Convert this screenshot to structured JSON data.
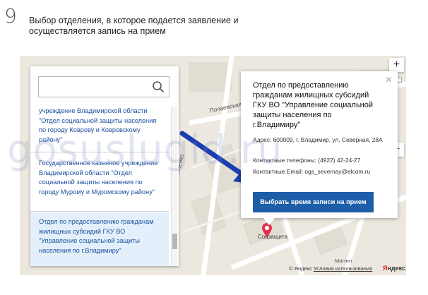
{
  "step": {
    "number": "9",
    "title": "Выбор отделения, в которое подается заявление и осуществляется запись на прием"
  },
  "search": {
    "placeholder": ""
  },
  "list": {
    "items": [
      {
        "label": "учреждение Владимирской области \"Отдел социальной защиты населения по городу Коврову и Ковровскому району\""
      },
      {
        "label": "Государственное казенное учреждение Владимирской области \"Отдел социальной защиты населения по городу Мурому и Муромскому району\""
      },
      {
        "label": "Отдел по предоставлению гражданам жилищных субсидий ГКУ ВО \"Управление социальной защиты населения по г.Владимиру\""
      }
    ]
  },
  "popup": {
    "close": "×",
    "title": "Отдел по предоставлению гражданам жилищных субсидий ГКУ ВО \"Управление социальной защиты населения по г.Владимиру\"",
    "address": "Адрес: 600009, г. Владимир, ул. Северная, 28А",
    "phone": "Контактные телефоны: (4922) 42-24-27",
    "email": "Контактные Email: ogs_severnay@elcom.ru",
    "button": "Выбрать время записи на прием"
  },
  "map": {
    "zoom_in": "+",
    "zoom_out": "−",
    "streets": {
      "pochaevskaya": "Почаевская",
      "osipenko": "ул. Полины Осипенко"
    },
    "poi_label": "Соцзащита",
    "magnit": "Магнит",
    "copyright": "© Яндекс",
    "terms": "Условия использования",
    "logo_ya": "Я",
    "logo_rest": "ндекс"
  },
  "watermark": "gosuslugid.ru",
  "colors": {
    "button": "#1d5ea8",
    "link": "#1b4f9c",
    "selected_bg": "#e3f0fb",
    "arrow": "#1a3fb0"
  }
}
